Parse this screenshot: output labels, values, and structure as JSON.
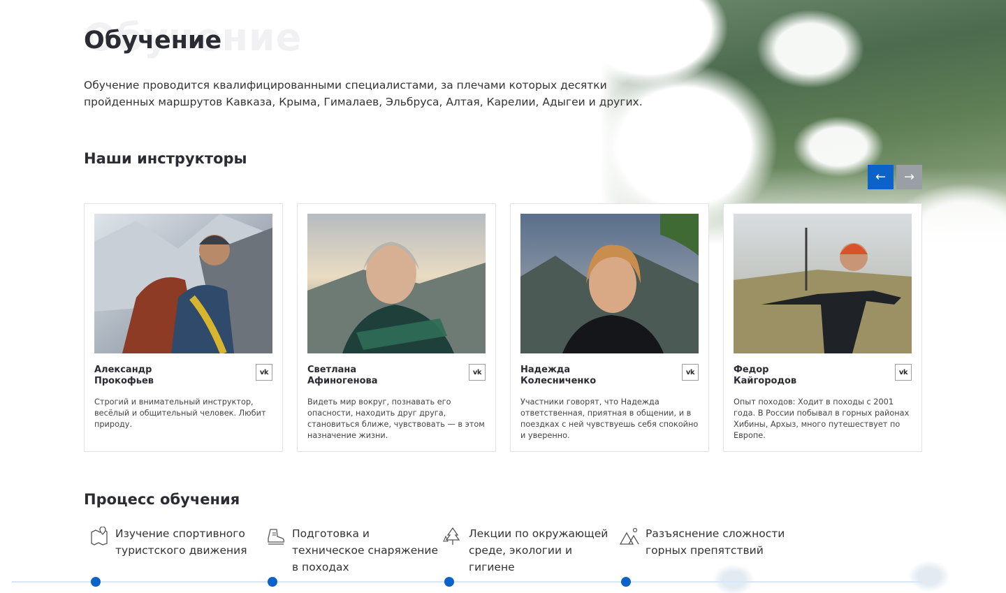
{
  "page": {
    "title_ghost": "Обучение",
    "title": "Обучение",
    "intro": "Обучение проводится квалифицированными специалистами, за плечами которых десятки пройденных маршрутов Кавказа, Крыма, Гималаев, Эльбруса, Алтая, Карелии, Адыгеи и других."
  },
  "instructors": {
    "heading": "Наши инструкторы",
    "prev_label": "←",
    "next_label": "→",
    "vk_label": "vk",
    "cards": [
      {
        "name_line1": "Александр",
        "name_line2": "Прокофьев",
        "description": "Строгий и внимательный инструктор, весёлый и общительный человек. Любит природу."
      },
      {
        "name_line1": "Светлана",
        "name_line2": "Афиногенова",
        "description": "Видеть мир вокруг, познавать его опасности, находить друг друга, становиться ближе, чувствовать — в этом назначение жизни."
      },
      {
        "name_line1": "Надежда",
        "name_line2": "Колесниченко",
        "description": "Участники говорят, что Надежда ответственная, приятная в общении, и в поездках с ней чувствуешь себя спокойно и уверенно."
      },
      {
        "name_line1": "Федор",
        "name_line2": "Кайгородов",
        "description": "Опыт походов: Ходит в походы с 2001 года. В России побывал в горных районах Хибины, Архыз, много путешествует по Европе."
      }
    ]
  },
  "process": {
    "heading": "Процесс обучения",
    "steps": [
      {
        "icon": "map-pin-icon",
        "text": "Изучение спортивного туристского движения"
      },
      {
        "icon": "hiking-boot-icon",
        "text": "Подготовка и техническое снаряжение в походах"
      },
      {
        "icon": "pine-trees-icon",
        "text": "Лекции по окружающей среде, экологии и гигиене"
      },
      {
        "icon": "mountains-icon",
        "text": "Разъяснение сложности горных препятствий"
      }
    ]
  },
  "colors": {
    "accent": "#0b63c9",
    "nav_inactive": "#9a9ea5",
    "text": "#2b2b33"
  }
}
